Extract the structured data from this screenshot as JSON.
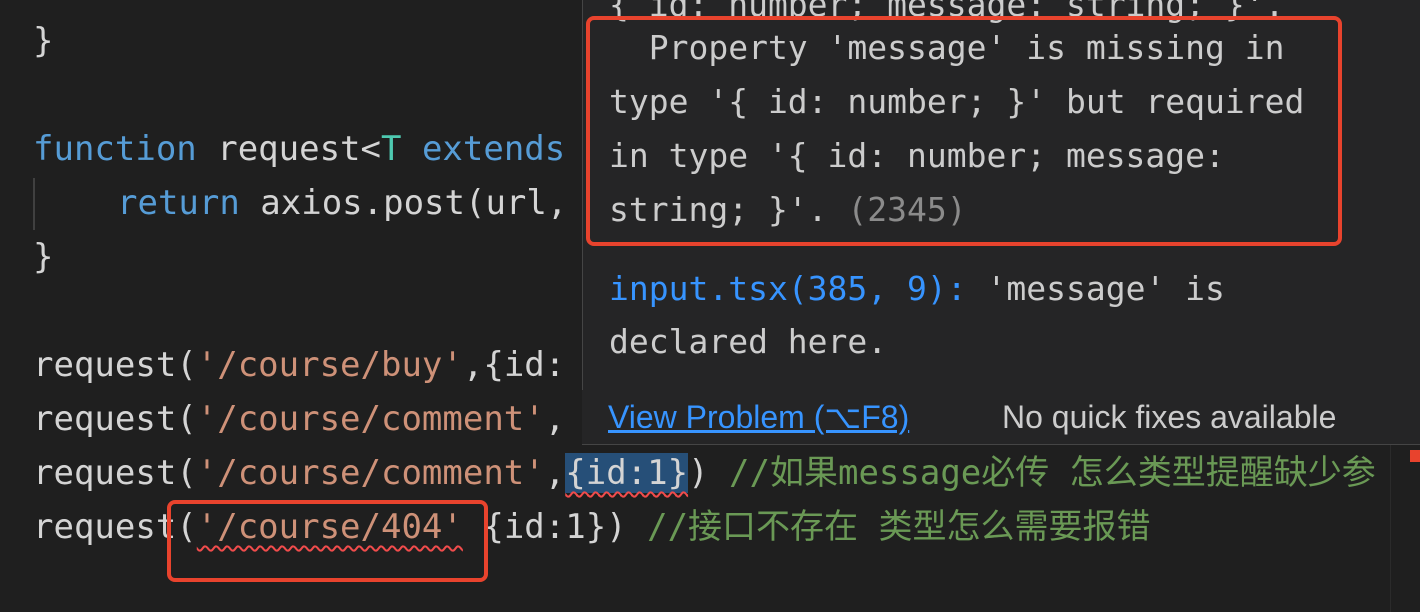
{
  "editor": {
    "line_close_brace_1": "}",
    "fn_keyword": "function",
    "fn_name": " request<",
    "fn_type_param": "T",
    "fn_extends": " extends",
    "ret_keyword": "return",
    "ret_rest": " axios.post(url,",
    "line_close_brace_2": "}",
    "call1_fn": "request(",
    "call1_str": "'/course/buy'",
    "call1_rest": ",{id:",
    "call2_fn": "request(",
    "call2_str": "'/course/comment'",
    "call2_rest": ",",
    "call3_fn": "request(",
    "call3_str": "'/course/comment'",
    "call3_comma": ",",
    "call3_arg": "{id:1}",
    "call3_close": ") ",
    "call3_comment": "//如果message必传 怎么类型提醒缺少参",
    "call4_fn": "request(",
    "call4_str": "'/course/404'",
    "call4_rest": " {id:1}) ",
    "call4_comment": "//接口不存在 类型怎么需要报错"
  },
  "hover": {
    "top_partial": "{ id: number; message: string; }'.",
    "msg_line1": "  Property 'message' is missing in",
    "msg_line2": "type '{ id: number; }' but required",
    "msg_line3": "in type '{ id: number; message:",
    "msg_line4_text": "string; }'.",
    "msg_code": " (2345)",
    "related_link": "input.tsx(385, 9):",
    "related_text1": " 'message' is",
    "related_text2": "declared here.",
    "view_problem": "View Problem (⌥F8)",
    "no_quick_fixes": "No quick fixes available"
  },
  "colors": {
    "annotation": "#e8432d",
    "error_squiggle": "#f14c4c"
  }
}
